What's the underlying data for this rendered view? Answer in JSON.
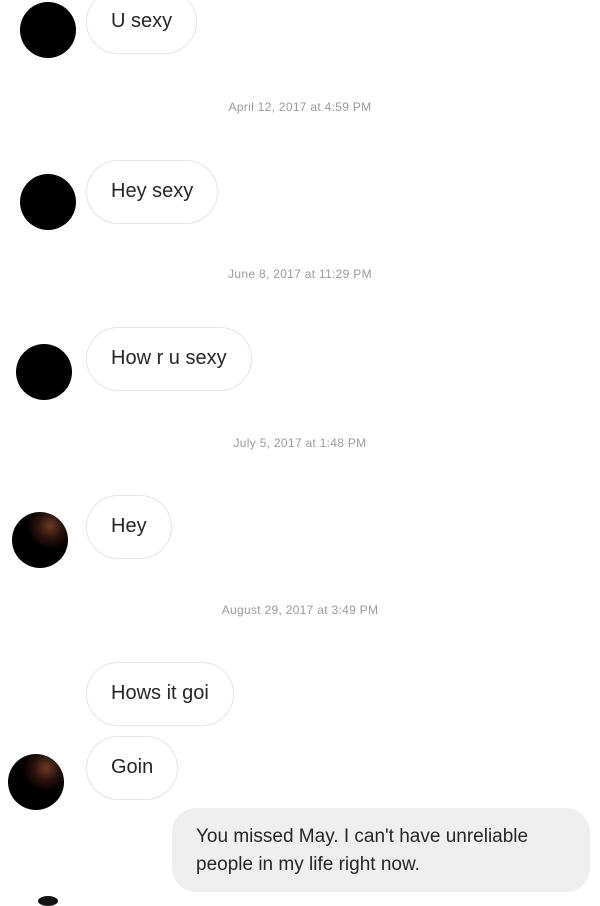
{
  "messages": {
    "m1": "U sexy",
    "m2": "Hey sexy",
    "m3": "How r u sexy",
    "m4": "Hey",
    "m5": "Hows it goi",
    "m6": "Goin",
    "reply": "You missed May. I can't have unreliable people in my life right now."
  },
  "timestamps": {
    "t1": "April 12, 2017 at 4:59 PM",
    "t2": "June 8, 2017 at 11:29 PM",
    "t3": "July 5, 2017 at 1:48 PM",
    "t4": "August 29, 2017 at 3:49 PM"
  },
  "colors": {
    "incoming_border": "#e4e4e4",
    "outgoing_bg": "#efefef",
    "timestamp_text": "#9a9a9a",
    "avatar": "#000000"
  }
}
